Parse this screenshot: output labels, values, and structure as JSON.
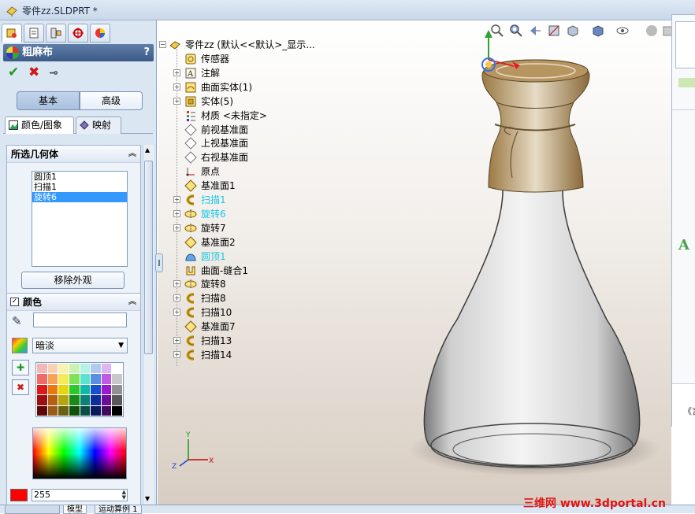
{
  "window": {
    "title": "零件zz.SLDPRT *"
  },
  "panel": {
    "header_title": "粗麻布",
    "help": "?",
    "mode_basic": "基本",
    "mode_advanced": "高级",
    "tab_color_image": "颜色/图象",
    "tab_mapping": "映射",
    "geometry_section": {
      "title": "所选几何体",
      "items": [
        {
          "label": "圆顶1",
          "selected": false
        },
        {
          "label": "扫描1",
          "selected": false
        },
        {
          "label": "旋转6",
          "selected": true
        }
      ],
      "remove_appearance_button": "移除外观"
    },
    "color_section": {
      "title": "颜色",
      "checked": true,
      "lighting_select": "暗淡",
      "value_input": "255",
      "current_color": "#ff0000"
    }
  },
  "tree": {
    "root": "零件zz (默认<<默认>_显示...",
    "nodes": [
      {
        "label": "传感器",
        "expand": false,
        "icon": "sensor-icon",
        "highlight": false
      },
      {
        "label": "注解",
        "expand": true,
        "icon": "annotation-icon",
        "highlight": false
      },
      {
        "label": "曲面实体(1)",
        "expand": true,
        "icon": "surface-body-icon",
        "highlight": false
      },
      {
        "label": "实体(5)",
        "expand": true,
        "icon": "solid-body-icon",
        "highlight": false
      },
      {
        "label": "材质 <未指定>",
        "expand": false,
        "icon": "material-icon",
        "highlight": false
      },
      {
        "label": "前视基准面",
        "expand": false,
        "icon": "plane-icon",
        "highlight": false
      },
      {
        "label": "上视基准面",
        "expand": false,
        "icon": "plane-icon",
        "highlight": false
      },
      {
        "label": "右视基准面",
        "expand": false,
        "icon": "plane-icon",
        "highlight": false
      },
      {
        "label": "原点",
        "expand": false,
        "icon": "origin-icon",
        "highlight": false
      },
      {
        "label": "基准面1",
        "expand": false,
        "icon": "plane-yellow-icon",
        "highlight": false
      },
      {
        "label": "扫描1",
        "expand": true,
        "icon": "sweep-icon",
        "highlight": true
      },
      {
        "label": "旋转6",
        "expand": true,
        "icon": "revolve-icon",
        "highlight": true
      },
      {
        "label": "旋转7",
        "expand": true,
        "icon": "revolve-icon",
        "highlight": false
      },
      {
        "label": "基准面2",
        "expand": false,
        "icon": "plane-yellow-icon",
        "highlight": false
      },
      {
        "label": "圆顶1",
        "expand": false,
        "icon": "dome-icon",
        "highlight": true
      },
      {
        "label": "曲面-缝合1",
        "expand": false,
        "icon": "knit-icon",
        "highlight": false
      },
      {
        "label": "旋转8",
        "expand": true,
        "icon": "revolve-icon",
        "highlight": false
      },
      {
        "label": "扫描8",
        "expand": true,
        "icon": "sweep-icon",
        "highlight": false
      },
      {
        "label": "扫描10",
        "expand": true,
        "icon": "sweep-icon",
        "highlight": false
      },
      {
        "label": "基准面7",
        "expand": false,
        "icon": "plane-yellow-icon",
        "highlight": false
      },
      {
        "label": "扫描13",
        "expand": true,
        "icon": "sweep-icon",
        "highlight": false
      },
      {
        "label": "扫描14",
        "expand": true,
        "icon": "sweep-icon",
        "highlight": false
      }
    ]
  },
  "bottom_tabs": {
    "model": "模型",
    "motion": "运动算例 1"
  },
  "triad": {
    "x": "X",
    "y": "Y",
    "z": "Z"
  },
  "taskpane": {
    "letter": "A",
    "bottom": "《言"
  },
  "watermark": "三维网 www.3dportal.cn"
}
